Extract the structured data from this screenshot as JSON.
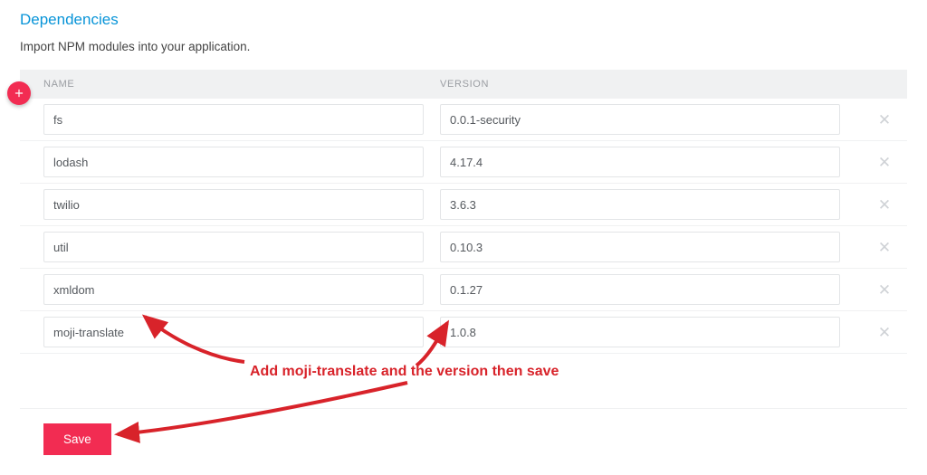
{
  "section": {
    "title": "Dependencies",
    "description": "Import NPM modules into your application."
  },
  "headers": {
    "name": "NAME",
    "version": "VERSION"
  },
  "rows": [
    {
      "name": "fs",
      "version": "0.0.1-security"
    },
    {
      "name": "lodash",
      "version": "4.17.4"
    },
    {
      "name": "twilio",
      "version": "3.6.3"
    },
    {
      "name": "util",
      "version": "0.10.3"
    },
    {
      "name": "xmldom",
      "version": "0.1.27"
    },
    {
      "name": "moji-translate",
      "version": "1.0.8"
    }
  ],
  "save_label": "Save",
  "annotation": "Add moji-translate and the version then save"
}
